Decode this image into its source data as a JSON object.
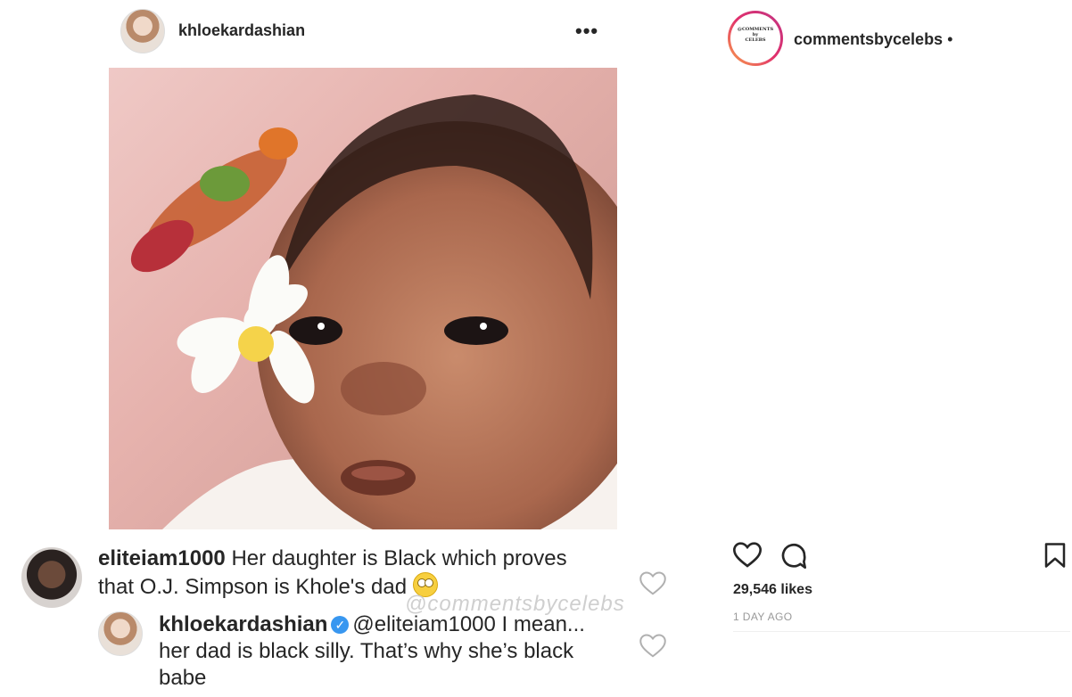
{
  "inner_post": {
    "username": "khloekardashian",
    "options_glyph": "•••",
    "photo_alt_icon": "baby-photo"
  },
  "comments": [
    {
      "username": "eliteiam1000",
      "text": "Her daughter is Black which proves that O.J. Simpson is Khole's dad",
      "emoji": "face-with-rolling-eyes-icon"
    },
    {
      "username": "khloekardashian",
      "verified_glyph": "✓",
      "mention": "@eliteiam1000",
      "text": "I mean... her dad is black silly. That’s why she’s black  babe"
    }
  ],
  "watermark": "@commentsbycelebs",
  "outer_post": {
    "avatar_logo_lines": [
      "@COMMENTS",
      "by",
      "CELEBS"
    ],
    "username": "commentsbycelebs",
    "separator": "•",
    "likes": "29,546 likes",
    "timestamp": "1 DAY AGO"
  },
  "colors": {
    "text": "#262626",
    "muted": "#999999",
    "verified": "#3897f0",
    "ring_gradient": [
      "#f9a34a",
      "#e1306c",
      "#c13584"
    ]
  }
}
